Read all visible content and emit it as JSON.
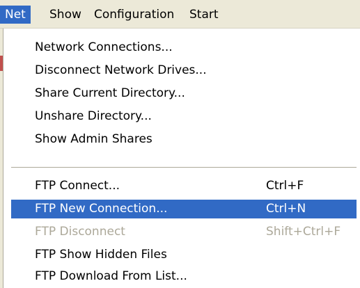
{
  "menubar": {
    "items": [
      {
        "label": "Net"
      },
      {
        "label": "Show"
      },
      {
        "label": "Configuration"
      },
      {
        "label": "Start"
      }
    ]
  },
  "menu": {
    "network_connections": {
      "label": "Network Connections..."
    },
    "disconnect_network_drives": {
      "label": "Disconnect Network Drives..."
    },
    "share_current_directory": {
      "label": "Share Current Directory..."
    },
    "unshare_directory": {
      "label": "Unshare Directory..."
    },
    "show_admin_shares": {
      "label": "Show Admin Shares"
    },
    "ftp_connect": {
      "label": "FTP Connect...",
      "shortcut": "Ctrl+F"
    },
    "ftp_new_connection": {
      "label": "FTP New Connection...",
      "shortcut": "Ctrl+N"
    },
    "ftp_disconnect": {
      "label": "FTP Disconnect",
      "shortcut": "Shift+Ctrl+F"
    },
    "ftp_show_hidden_files": {
      "label": "FTP Show Hidden Files"
    },
    "ftp_download_from_list": {
      "label": "FTP Download From List..."
    }
  },
  "colors": {
    "highlight": "#316ac5",
    "menubar_bg": "#ece9d8",
    "disabled_text": "#aca899"
  }
}
